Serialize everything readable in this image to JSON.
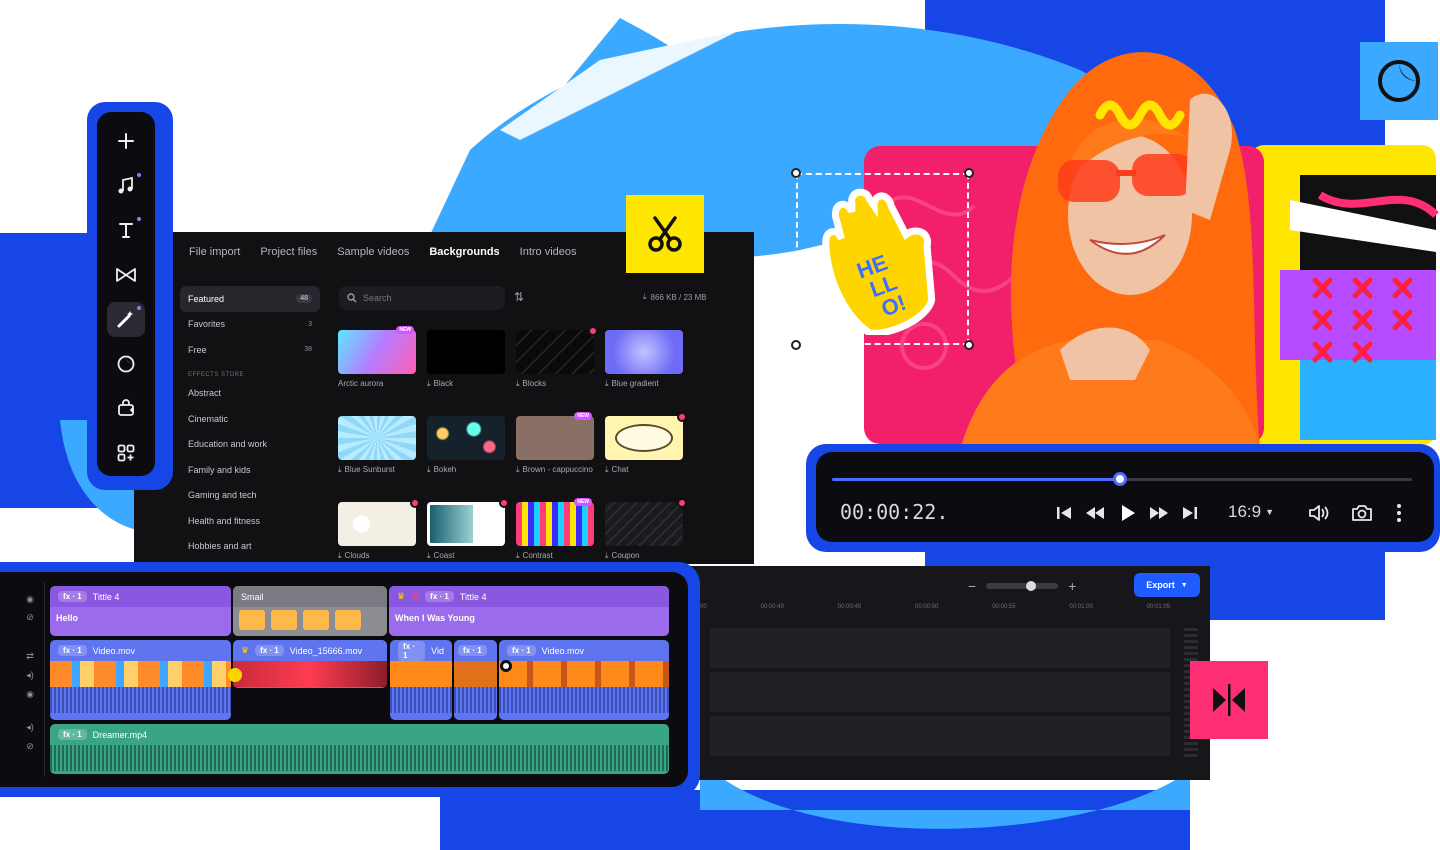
{
  "colors": {
    "brand_blue": "#1646e6",
    "accent_yellow": "#ffe600",
    "accent_pink": "#ff2f73",
    "accent_sky": "#3aa9ff",
    "panel_dark": "#111114"
  },
  "toolbar": {
    "items": [
      {
        "icon": "plus-icon",
        "active": false,
        "dot": false
      },
      {
        "icon": "music-note-icon",
        "active": false,
        "dot": true
      },
      {
        "icon": "text-icon",
        "active": false,
        "dot": true
      },
      {
        "icon": "transition-icon",
        "active": false,
        "dot": false
      },
      {
        "icon": "magic-wand-icon",
        "active": true,
        "dot": true
      },
      {
        "icon": "sticker-icon",
        "active": false,
        "dot": false
      },
      {
        "icon": "brand-kit-icon",
        "active": false,
        "dot": false
      },
      {
        "icon": "apps-icon",
        "active": false,
        "dot": false
      }
    ]
  },
  "library": {
    "tabs": [
      "File import",
      "Project files",
      "Sample videos",
      "Backgrounds",
      "Intro videos"
    ],
    "selected_tab": "Backgrounds",
    "search_placeholder": "Search",
    "storage": "866 KB / 23 MB",
    "categories_top": [
      {
        "label": "Featured",
        "count": "48"
      },
      {
        "label": "Favorites",
        "count": "3"
      },
      {
        "label": "Free",
        "count": "38"
      }
    ],
    "section_header": "EFFECTS STORE",
    "categories": [
      "Abstract",
      "Cinematic",
      "Education and work",
      "Family and kids",
      "Gaming and tech",
      "Health and fitness",
      "Hobbies and art"
    ],
    "thumbnails": [
      {
        "label": "Arctic aurora",
        "badge": "NEW",
        "download": false
      },
      {
        "label": "Black",
        "badge": "",
        "download": true
      },
      {
        "label": "Blocks",
        "badge": "premium",
        "download": true
      },
      {
        "label": "Blue gradient",
        "badge": "",
        "download": true
      },
      {
        "label": "Blue Sunburst",
        "badge": "",
        "download": true
      },
      {
        "label": "Bokeh",
        "badge": "",
        "download": true
      },
      {
        "label": "Brown - cappuccino",
        "badge": "NEW",
        "download": true
      },
      {
        "label": "Chat",
        "badge": "premium",
        "download": true
      },
      {
        "label": "Clouds",
        "badge": "premium",
        "download": true
      },
      {
        "label": "Coast",
        "badge": "premium",
        "download": true
      },
      {
        "label": "Contrast",
        "badge": "NEW",
        "download": true
      },
      {
        "label": "Coupon",
        "badge": "premium",
        "download": true
      }
    ]
  },
  "preview": {
    "sticker_text": "HELLO!"
  },
  "player": {
    "timecode": "00:00:22.",
    "progress": 0.5,
    "aspect_ratio": "16:9"
  },
  "timeline": {
    "export_label": "Export",
    "ruler": [
      "00",
      "00:00:40",
      "00:00:45",
      "00:00:50",
      "00:00:55",
      "00:01:00",
      "00:01:05"
    ],
    "clips": {
      "title_a": {
        "fx": "fx · 1",
        "name": "Tittle 4",
        "text": "Hello"
      },
      "smail": {
        "name": "Smail"
      },
      "title_b": {
        "fx": "fx · 1",
        "name": "Tittle 4",
        "text": "When I Was Young"
      },
      "video_a": {
        "fx": "fx · 1",
        "name": "Video.mov"
      },
      "video_b": {
        "fx": "fx · 1",
        "name": "Video_15666.mov"
      },
      "video_c": {
        "fx": "fx · 1",
        "name": "Vid"
      },
      "video_d": {
        "fx": "fx · 1",
        "name": ""
      },
      "video_e": {
        "fx": "fx · 1",
        "name": "Video.mov"
      },
      "audio": {
        "fx": "fx · 1",
        "name": "Dreamer.mp4"
      }
    }
  }
}
